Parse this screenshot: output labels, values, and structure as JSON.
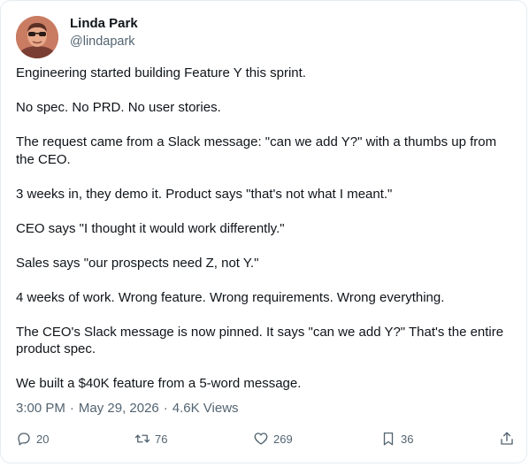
{
  "author": {
    "name": "Linda Park",
    "handle": "@lindapark",
    "avatar_icon": "profile-photo"
  },
  "tweet": {
    "paragraphs": [
      "Engineering started building Feature Y this sprint.",
      "No spec. No PRD. No user stories.",
      "The request came from a Slack message: \"can we add Y?\" with a thumbs up from the CEO.",
      "3 weeks in, they demo it. Product says \"that's not what I meant.\"",
      "CEO says \"I thought it would work differently.\"",
      "Sales says \"our prospects need Z, not Y.\"",
      "4 weeks of work. Wrong feature. Wrong requirements. Wrong everything.",
      "The CEO's Slack message is now pinned. It says \"can we add Y?\" That's the entire product spec.",
      "We built a $40K feature from a 5-word message."
    ],
    "time": "3:00 PM",
    "date": "May 29, 2026",
    "views": "4.6K Views"
  },
  "actions": {
    "replies": "20",
    "retweets": "76",
    "likes": "269",
    "bookmarks": "36"
  }
}
